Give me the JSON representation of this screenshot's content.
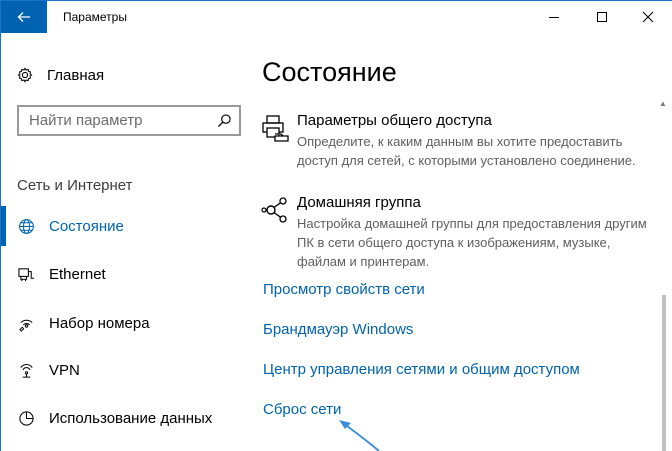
{
  "window": {
    "title": "Параметры",
    "back_icon": "arrow-left-icon",
    "controls": [
      "minimize-icon",
      "maximize-icon",
      "close-icon"
    ],
    "accent_color": "#0063b1"
  },
  "sidebar": {
    "home_label": "Главная",
    "search_placeholder": "Найти параметр",
    "section_label": "Сеть и Интернет",
    "items": [
      {
        "label": "Состояние",
        "icon": "globe-icon",
        "active": true
      },
      {
        "label": "Ethernet",
        "icon": "ethernet-icon",
        "active": false
      },
      {
        "label": "Набор номера",
        "icon": "dialup-icon",
        "active": false
      },
      {
        "label": "VPN",
        "icon": "vpn-icon",
        "active": false
      },
      {
        "label": "Использование данных",
        "icon": "data-usage-icon",
        "active": false
      }
    ]
  },
  "main": {
    "title": "Состояние",
    "settings": [
      {
        "title": "Параметры общего доступа",
        "description": "Определите, к каким данным вы хотите предоставить доступ для сетей, с которыми установлено соединение.",
        "icon": "sharing-printer-icon"
      },
      {
        "title": "Домашняя группа",
        "description": "Настройка домашней группы для предоставления другим ПК в сети общего доступа к изображениям, музыке, файлам и принтерам.",
        "icon": "homegroup-icon"
      }
    ],
    "links": [
      "Просмотр свойств сети",
      "Брандмауэр Windows",
      "Центр управления сетями и общим доступом",
      "Сброс сети"
    ]
  }
}
